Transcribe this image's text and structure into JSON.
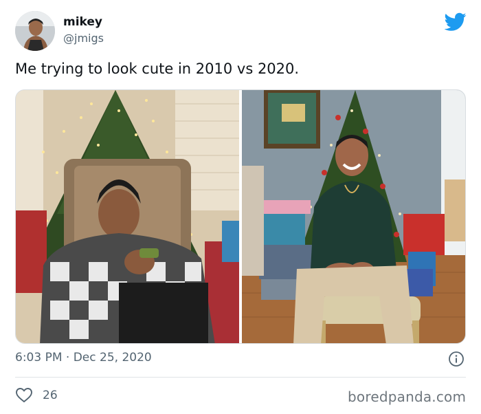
{
  "tweet": {
    "author_name": "mikey",
    "author_handle": "@jmigs",
    "text": "Me trying to look cute in 2010 vs 2020.",
    "timestamp": "6:03 PM · Dec 25, 2020",
    "likes": "26",
    "avatar": "avatar-photo",
    "platform_icon": "twitter-bird-icon",
    "accent_color": "#1d9bf0"
  },
  "media": {
    "left_photo": "photo-2010-christmas-tree-armchair",
    "right_photo": "photo-2020-christmas-tree-gifts"
  },
  "footer": {
    "watermark": "boredpanda.com"
  }
}
